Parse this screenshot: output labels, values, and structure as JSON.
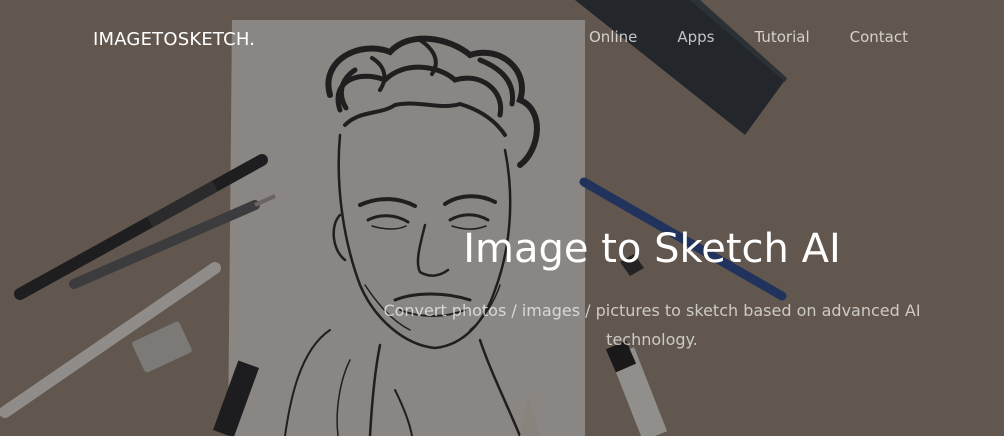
{
  "navbar": {
    "brand": "IMAGETOSKETCH.",
    "links": [
      {
        "label": "Online"
      },
      {
        "label": "Apps"
      },
      {
        "label": "Tutorial"
      },
      {
        "label": "Contact"
      }
    ]
  },
  "hero": {
    "title": "Image to Sketch AI",
    "subtitle": "Convert photos / images / pictures to sketch based on advanced AI technology.",
    "background": "sketch-portrait-on-paper-with-pencils",
    "colors": {
      "desk": "#8e7f6c",
      "paper": "#c9c7c2",
      "overlay": "#282424",
      "text": "#ffffff"
    }
  }
}
